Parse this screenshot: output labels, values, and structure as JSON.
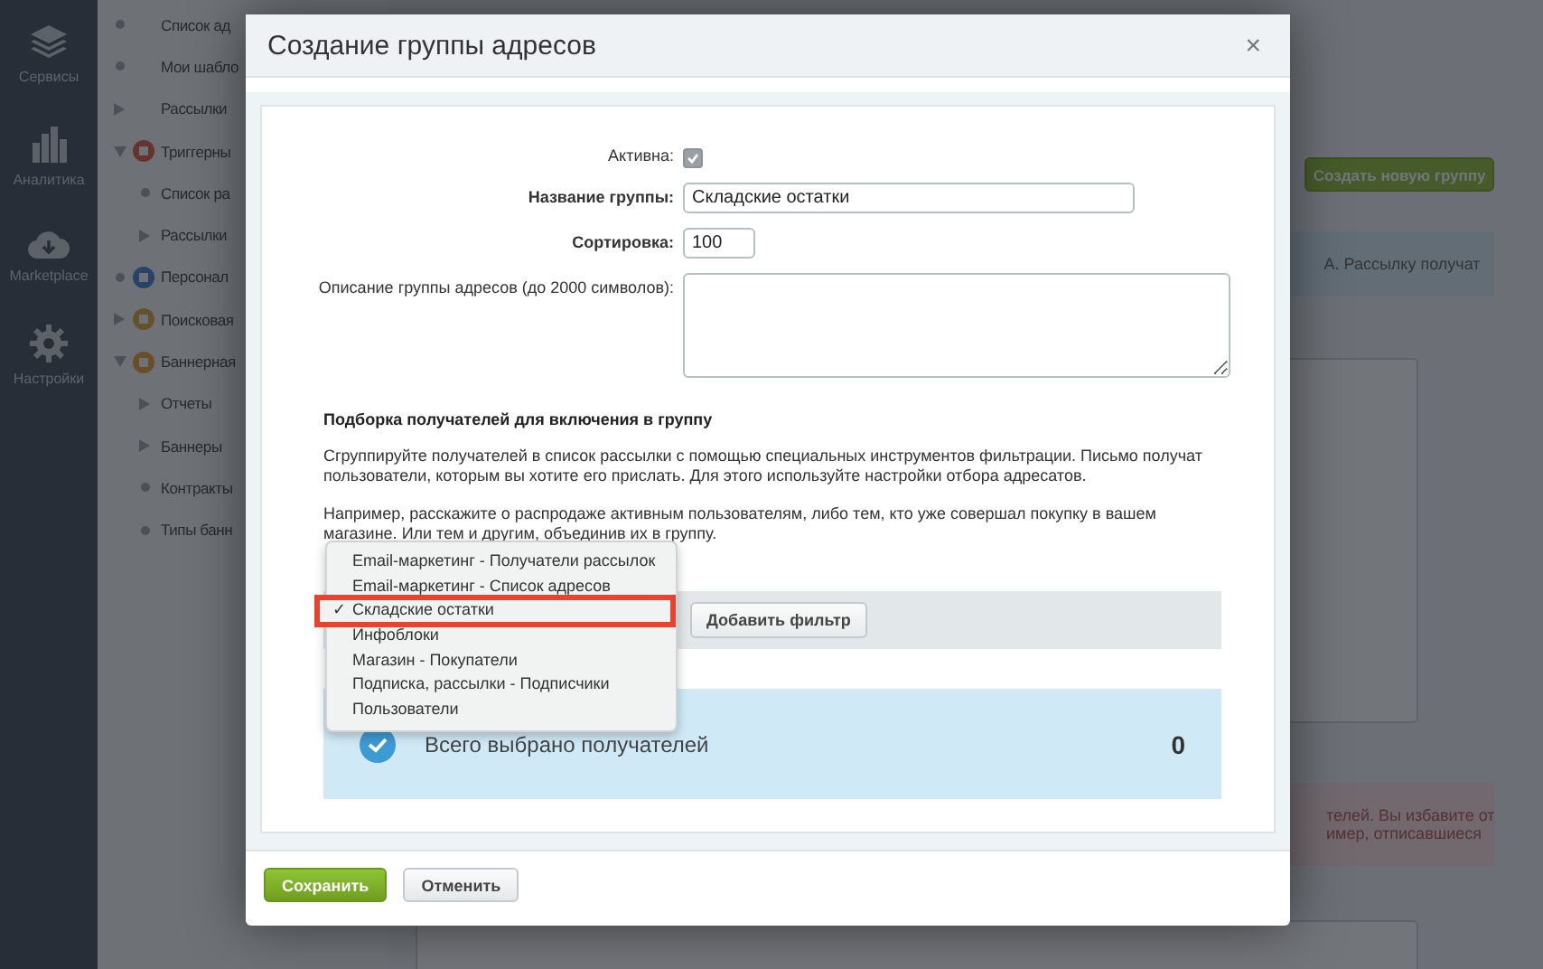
{
  "sidebar": {
    "items": [
      {
        "label": "Сервисы"
      },
      {
        "label": "Аналитика"
      },
      {
        "label": "Marketplace"
      },
      {
        "label": "Настройки"
      }
    ]
  },
  "menu": {
    "items": [
      {
        "label": "Список ад",
        "kind": "leaf"
      },
      {
        "label": "Мои шабло",
        "kind": "leaf"
      },
      {
        "label": "Рассылки",
        "kind": "branch",
        "expanded": false
      },
      {
        "label": "Триггерны",
        "kind": "section",
        "expanded": true,
        "children": [
          {
            "label": "Список ра",
            "kind": "leaf"
          },
          {
            "label": "Рассылки",
            "kind": "branch",
            "expanded": false
          }
        ]
      },
      {
        "label": "Персонал",
        "kind": "section"
      },
      {
        "label": "Поисковая",
        "kind": "section",
        "expanded": false
      },
      {
        "label": "Баннерная",
        "kind": "section",
        "expanded": true,
        "children": [
          {
            "label": "Отчеты",
            "kind": "branch",
            "expanded": false
          },
          {
            "label": "Баннеры",
            "kind": "branch",
            "expanded": false
          },
          {
            "label": "Контракты",
            "kind": "leaf"
          },
          {
            "label": "Типы банн",
            "kind": "leaf"
          }
        ]
      }
    ]
  },
  "page": {
    "create_button": "Создать новую группу",
    "info_note": "А. Рассылку получат",
    "warning_note": [
      "телей. Вы избавите от",
      "имер, отписавшиеся"
    ]
  },
  "dialog": {
    "title": "Создание группы адресов",
    "close": "×",
    "fields": [
      {
        "kind": "checkbox",
        "label": "Активна:",
        "checked": true
      },
      {
        "kind": "text",
        "label": "Название группы:",
        "required": true,
        "value": "Складские остатки"
      },
      {
        "kind": "number",
        "label": "Сортировка:",
        "required": true,
        "value": "100"
      },
      {
        "kind": "textarea",
        "label": "Описание группы адресов (до 2000 символов):"
      }
    ],
    "section_title": "Подборка получателей для включения в группу",
    "paragraphs": [
      "Сгруппируйте получателей в список рассылки с помощью специальных инструментов фильтрации. Письмо получат пользователи, которым вы хотите его прислать. Для этого используйте настройки отбора адресатов.",
      "Например, расскажите о распродаже активным пользователям, либо тем, кто уже совершал покупку в вашем магазине. Или тем и другим, объединив их в группу."
    ],
    "add_filter_button": "Добавить фильтр",
    "total": {
      "label": "Всего выбрано получателей",
      "value": "0"
    },
    "source_menu": {
      "check": "✓",
      "items": [
        {
          "label": "Email-маркетинг - Получатели рассылок",
          "selected": false
        },
        {
          "label": "Email-маркетинг - Список адресов",
          "selected": false
        },
        {
          "label": "Складские остатки",
          "selected": true
        },
        {
          "label": "Инфоблоки",
          "selected": false
        },
        {
          "label": "Магазин - Покупатели",
          "selected": false
        },
        {
          "label": "Подписка, рассылки - Подписчики",
          "selected": false
        },
        {
          "label": "Пользователи",
          "selected": false
        }
      ]
    },
    "buttons": [
      {
        "label": "Сохранить",
        "kind": "primary"
      },
      {
        "label": "Отменить",
        "kind": "secondary"
      }
    ]
  }
}
